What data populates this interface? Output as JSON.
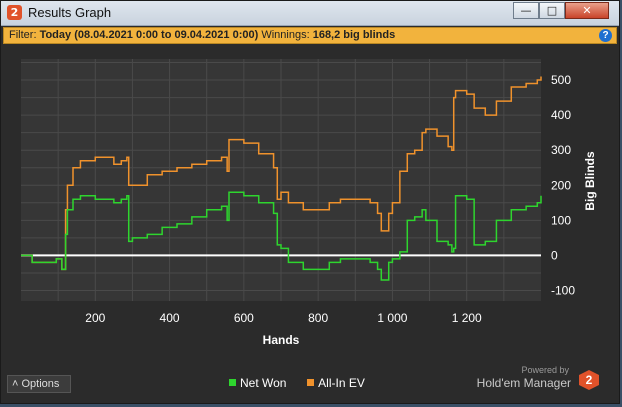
{
  "window": {
    "title": "Results Graph",
    "app_icon": "2"
  },
  "filter": {
    "prefix": "Filter:",
    "value": "Today (08.04.2021 0:00 to 09.04.2021 0:00)",
    "winnings_label": "Winnings:",
    "winnings_value": "168,2 big blinds"
  },
  "footer": {
    "options_label": "Options",
    "powered_by": "Powered by",
    "brand": "Hold'em Manager",
    "brand_logo": "2"
  },
  "colors": {
    "net_won": "#2ed52e",
    "all_in_ev": "#f0922c",
    "zero_line": "#ffffff",
    "plot_bg": "#363636",
    "grid": "#4a4a4a"
  },
  "chart_data": {
    "type": "line",
    "xlabel": "Hands",
    "ylabel": "Big Blinds",
    "xlim": [
      0,
      1400
    ],
    "ylim": [
      -130,
      560
    ],
    "x_ticks": [
      200,
      400,
      600,
      800,
      1000,
      1200
    ],
    "x_tick_labels": [
      "200",
      "400",
      "600",
      "800",
      "1 000",
      "1 200"
    ],
    "y_ticks": [
      -100,
      0,
      100,
      200,
      300,
      400,
      500
    ],
    "grid": true,
    "legend_position": "bottom",
    "series": [
      {
        "name": "Net Won",
        "x": [
          0,
          30,
          60,
          95,
          110,
          120,
          125,
          140,
          160,
          200,
          250,
          270,
          285,
          290,
          300,
          340,
          380,
          420,
          460,
          500,
          540,
          555,
          560,
          600,
          640,
          680,
          690,
          700,
          720,
          760,
          800,
          830,
          860,
          900,
          940,
          960,
          970,
          990,
          1000,
          1020,
          1040,
          1060,
          1080,
          1090,
          1120,
          1150,
          1160,
          1165,
          1170,
          1200,
          1220,
          1250,
          1280,
          1320,
          1360,
          1390,
          1400
        ],
        "values": [
          0,
          -20,
          -20,
          -10,
          -40,
          60,
          130,
          160,
          170,
          160,
          150,
          160,
          170,
          40,
          50,
          60,
          80,
          90,
          110,
          130,
          140,
          100,
          180,
          170,
          150,
          120,
          30,
          20,
          -20,
          -40,
          -40,
          -20,
          -10,
          -10,
          -20,
          -40,
          -70,
          -20,
          -10,
          10,
          100,
          110,
          130,
          100,
          40,
          30,
          10,
          20,
          170,
          160,
          30,
          40,
          100,
          130,
          140,
          150,
          170
        ]
      },
      {
        "name": "All-In EV",
        "x": [
          0,
          30,
          60,
          95,
          110,
          120,
          125,
          140,
          160,
          200,
          250,
          270,
          285,
          290,
          300,
          340,
          380,
          420,
          460,
          500,
          540,
          555,
          560,
          600,
          640,
          680,
          690,
          700,
          720,
          760,
          800,
          830,
          860,
          900,
          940,
          960,
          970,
          990,
          1000,
          1020,
          1040,
          1060,
          1080,
          1090,
          1120,
          1150,
          1160,
          1165,
          1170,
          1200,
          1220,
          1250,
          1280,
          1320,
          1360,
          1390,
          1400
        ],
        "values": [
          0,
          -20,
          -20,
          -10,
          -40,
          130,
          200,
          250,
          270,
          280,
          260,
          270,
          280,
          200,
          200,
          230,
          240,
          250,
          260,
          270,
          280,
          240,
          330,
          320,
          290,
          250,
          160,
          180,
          150,
          130,
          130,
          150,
          160,
          160,
          150,
          120,
          70,
          120,
          150,
          240,
          290,
          300,
          350,
          360,
          340,
          310,
          300,
          450,
          470,
          460,
          420,
          400,
          440,
          480,
          490,
          500,
          510
        ]
      }
    ]
  }
}
